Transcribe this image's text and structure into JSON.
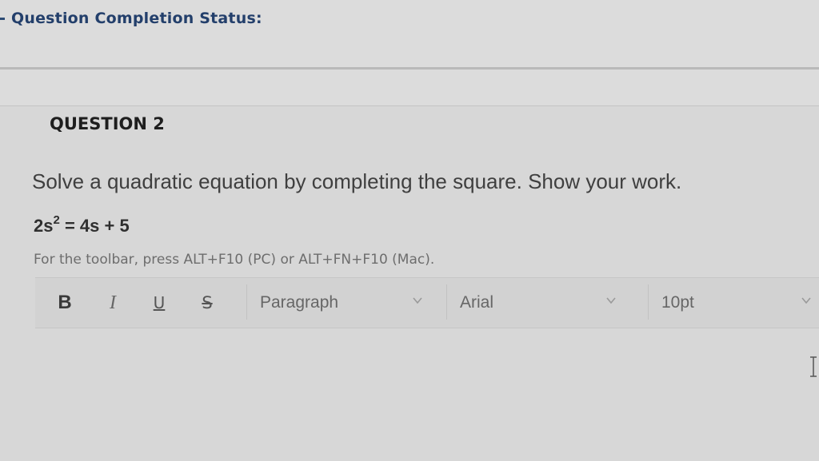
{
  "header": {
    "status_title": "Question Completion Status:"
  },
  "question": {
    "number_label": "QUESTION 2",
    "prompt": "Solve a quadratic equation by completing the square. Show your work.",
    "equation": {
      "lhs_base": "2s",
      "exponent": "2",
      "rhs": " = 4s + 5"
    },
    "toolbar_hint": "For the toolbar, press ALT+F10 (PC) or ALT+FN+F10 (Mac)."
  },
  "toolbar": {
    "bold_label": "B",
    "italic_label": "I",
    "underline_label": "U",
    "strike_label": "S",
    "paragraph_select": "Paragraph",
    "font_select": "Arial",
    "size_select": "10pt",
    "chevron_icon": "chevron-down-icon",
    "cursor_icon": "text-cursor-icon"
  },
  "colors": {
    "status_title": "#233f6b",
    "background": "#dcdcdc"
  }
}
